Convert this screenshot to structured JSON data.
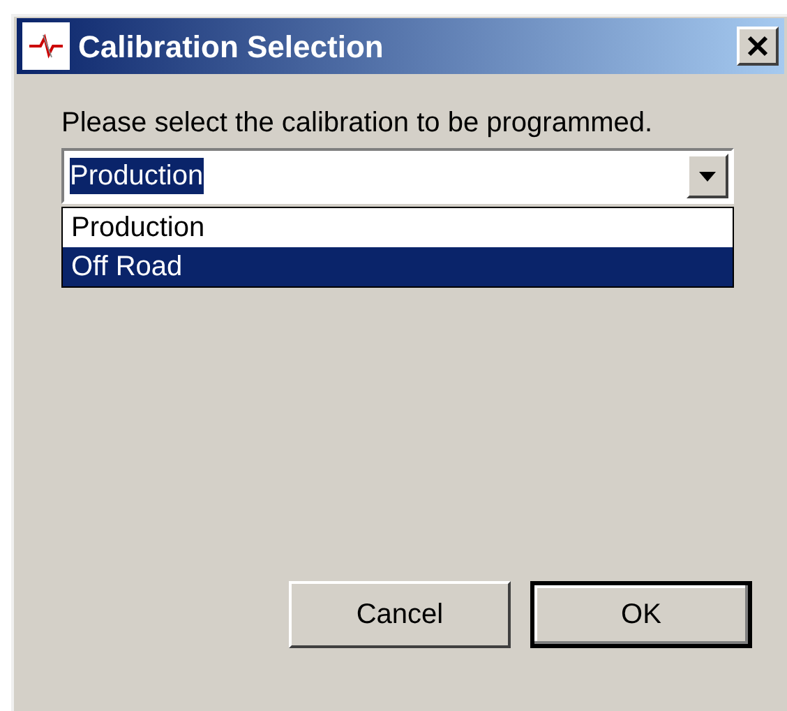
{
  "window": {
    "title": "Calibration Selection"
  },
  "prompt": "Please select the calibration to be programmed.",
  "combo": {
    "value": "Production",
    "expanded": true,
    "options": [
      {
        "label": "Production",
        "highlighted": false
      },
      {
        "label": "Off Road",
        "highlighted": true
      }
    ]
  },
  "buttons": [
    {
      "label": "Cancel",
      "default": false
    },
    {
      "label": "OK",
      "default": true
    }
  ]
}
